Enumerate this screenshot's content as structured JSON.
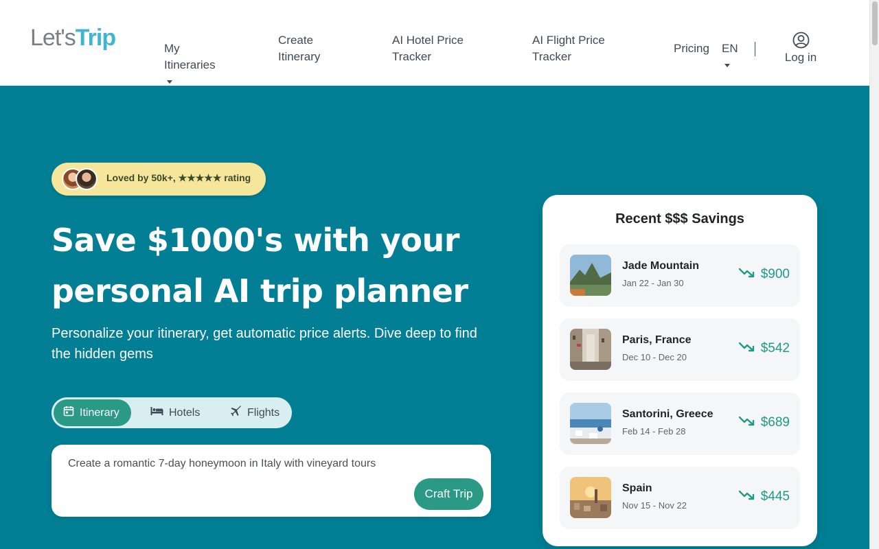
{
  "brand": {
    "logo_part1": "Let's",
    "logo_part2": "Trip"
  },
  "nav": {
    "my_itineraries": "My Itineraries",
    "create_itinerary": "Create Itinerary",
    "hotel_tracker": "AI Hotel Price Tracker",
    "flight_tracker": "AI Flight Price Tracker",
    "pricing": "Pricing",
    "language": "EN",
    "login": "Log in"
  },
  "hero": {
    "badge_text": "Loved by 50k+, ★★★★★ rating",
    "title": "Save $1000's with your personal AI trip planner",
    "subtitle": "Personalize your itinerary, get automatic price alerts. Dive deep to find the hidden gems",
    "tabs": [
      {
        "label": "Itinerary",
        "icon": "calendar-icon",
        "active": true
      },
      {
        "label": "Hotels",
        "icon": "bed-icon",
        "active": false
      },
      {
        "label": "Flights",
        "icon": "airplane-icon",
        "active": false
      }
    ],
    "prompt_text": "Create a romantic 7-day honeymoon in Italy with vineyard tours",
    "craft_button": "Craft Trip"
  },
  "savings": {
    "title": "Recent $$$ Savings",
    "items": [
      {
        "name": "Jade Mountain",
        "dates": "Jan 22 - Jan 30",
        "amount": "$900",
        "thumb": "mountain-photo"
      },
      {
        "name": "Paris, France",
        "dates": "Dec 10 - Dec 20",
        "amount": "$542",
        "thumb": "paris-street-photo"
      },
      {
        "name": "Santorini, Greece",
        "dates": "Feb 14 - Feb 28",
        "amount": "$689",
        "thumb": "santorini-photo"
      },
      {
        "name": "Spain",
        "dates": "Nov 15 - Nov 22",
        "amount": "$445",
        "thumb": "spain-city-photo"
      }
    ]
  },
  "colors": {
    "hero_bg": "#027f94",
    "accent_green": "#2a9a87",
    "badge_bg": "#f5e69c",
    "logo_trip": "#3fb5d0"
  }
}
